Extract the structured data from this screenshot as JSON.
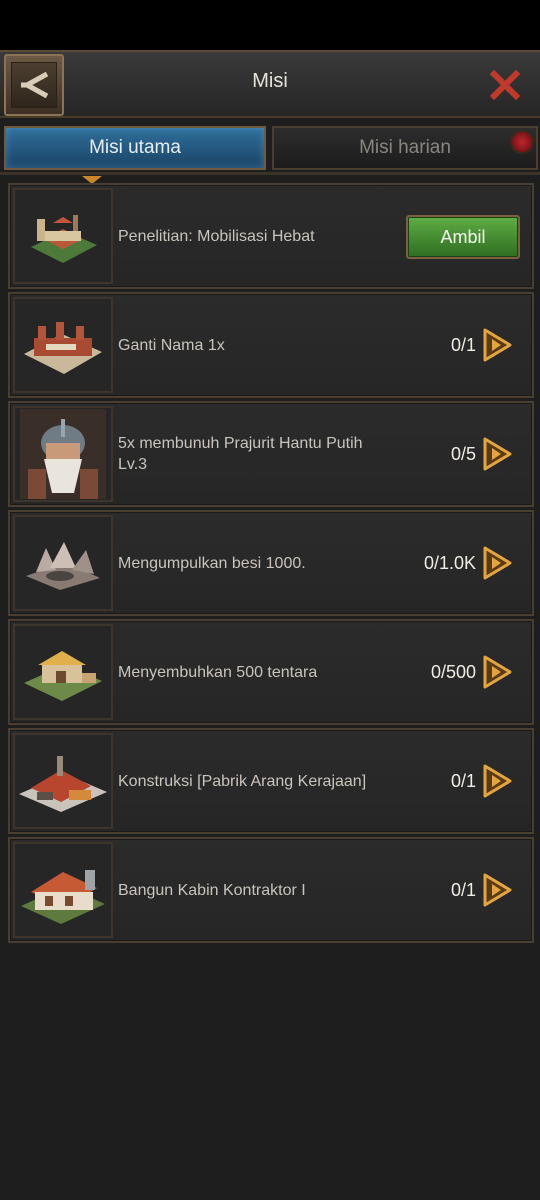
{
  "header": {
    "title": "Misi"
  },
  "tabs": [
    {
      "label": "Misi utama",
      "active": true
    },
    {
      "label": "Misi harian",
      "active": false
    }
  ],
  "missions": [
    {
      "icon": "castle-research-icon",
      "label": "Penelitian: Mobilisasi Hebat",
      "action": "Ambil"
    },
    {
      "icon": "city-icon",
      "label": "Ganti Nama 1x",
      "progress": "0/1"
    },
    {
      "icon": "warrior-portrait-icon",
      "label": "5x membunuh Prajurit Hantu Putih Lv.3",
      "progress": "0/5"
    },
    {
      "icon": "iron-ore-icon",
      "label": "Mengumpulkan besi 1000.",
      "progress": "0/1.0K"
    },
    {
      "icon": "hospital-building-icon",
      "label": "Menyembuhkan 500 tentara",
      "progress": "0/500"
    },
    {
      "icon": "charcoal-factory-icon",
      "label": "Konstruksi [Pabrik Arang Kerajaan]",
      "progress": "0/1"
    },
    {
      "icon": "contractor-cabin-icon",
      "label": "Bangun Kabin Kontraktor I",
      "progress": "0/1"
    }
  ],
  "colors": {
    "accent": "#c9862a",
    "tab_active": "#2f6f9c",
    "claim": "#4b8f35",
    "close": "#c0392b"
  }
}
